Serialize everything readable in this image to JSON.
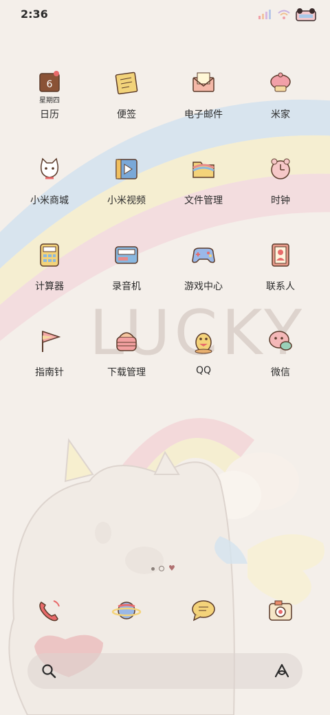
{
  "status": {
    "time": "2:36",
    "icons": [
      "signal-icon",
      "wifi-icon",
      "battery-icon"
    ]
  },
  "apps": [
    {
      "label": "日历",
      "icon": "calendar-icon",
      "badge": "6",
      "sub": "星期四"
    },
    {
      "label": "便签",
      "icon": "notes-icon"
    },
    {
      "label": "电子邮件",
      "icon": "mail-icon"
    },
    {
      "label": "米家",
      "icon": "mijia-icon"
    },
    {
      "label": "小米商城",
      "icon": "cat-store-icon"
    },
    {
      "label": "小米视频",
      "icon": "video-icon"
    },
    {
      "label": "文件管理",
      "icon": "folder-icon"
    },
    {
      "label": "时钟",
      "icon": "clock-icon"
    },
    {
      "label": "计算器",
      "icon": "calculator-icon"
    },
    {
      "label": "录音机",
      "icon": "recorder-icon"
    },
    {
      "label": "游戏中心",
      "icon": "gamepad-icon"
    },
    {
      "label": "联系人",
      "icon": "contacts-icon"
    },
    {
      "label": "指南针",
      "icon": "compass-icon"
    },
    {
      "label": "下载管理",
      "icon": "download-icon"
    },
    {
      "label": "QQ",
      "icon": "qq-icon"
    },
    {
      "label": "微信",
      "icon": "wechat-icon"
    }
  ],
  "dock": [
    {
      "name": "phone-icon"
    },
    {
      "name": "browser-planet-icon"
    },
    {
      "name": "messages-icon"
    },
    {
      "name": "camera-icon"
    }
  ],
  "page_indicator": {
    "pages": 3,
    "current": 2
  },
  "wallpaper": {
    "text": "LUCKY"
  },
  "colors": {
    "background": "#f4efea",
    "rainbow_blue": "#c8d8ec",
    "rainbow_yellow": "#f4ebc6",
    "rainbow_pink": "#f2d4d8",
    "label": "#2b2b2b",
    "icon_outline": "#5a3a2a"
  }
}
